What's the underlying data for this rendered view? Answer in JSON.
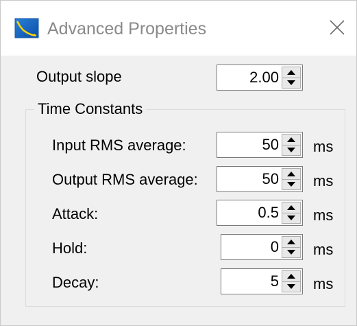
{
  "window": {
    "title": "Advanced Properties",
    "icon": "app-icon",
    "close_icon": "close-icon"
  },
  "output_slope": {
    "label": "Output slope",
    "value": "2.00"
  },
  "time_constants": {
    "group_title": "Time Constants",
    "rows": [
      {
        "label": "Input RMS average:",
        "value": "50",
        "unit": "ms"
      },
      {
        "label": "Output RMS average:",
        "value": "50",
        "unit": "ms"
      },
      {
        "label": "Attack:",
        "value": "0.5",
        "unit": "ms"
      },
      {
        "label": "Hold:",
        "value": "0",
        "unit": "ms"
      },
      {
        "label": "Decay:",
        "value": "5",
        "unit": "ms"
      }
    ]
  },
  "colors": {
    "titlebar_bg": "#ffffff",
    "dialog_bg": "#f0f0f0",
    "title_text": "#8a8a8a"
  }
}
